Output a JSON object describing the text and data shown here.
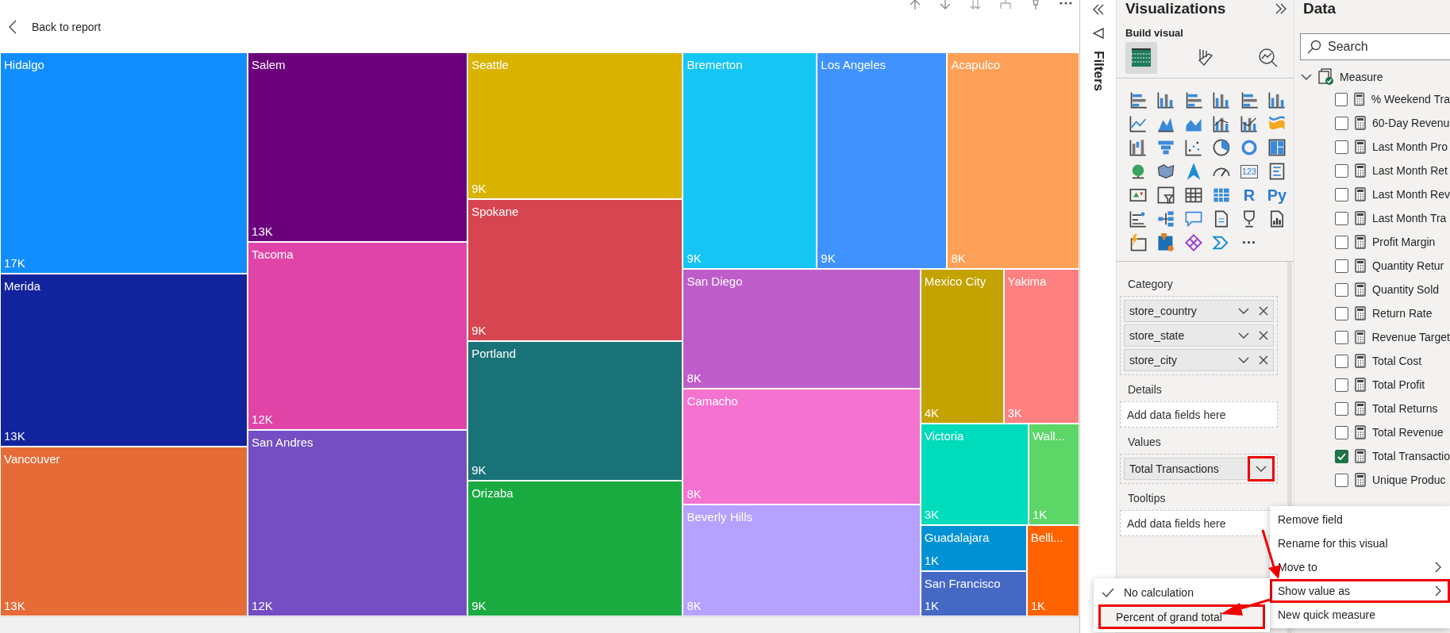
{
  "report": {
    "back_link": "Back to report"
  },
  "treemap": {
    "tiles": [
      {
        "name": "Hidalgo",
        "value": "17K",
        "color": "#118dff"
      },
      {
        "name": "Merida",
        "value": "13K",
        "color": "#12239e"
      },
      {
        "name": "Vancouver",
        "value": "13K",
        "color": "#e66c37"
      },
      {
        "name": "Salem",
        "value": "13K",
        "color": "#6b007b"
      },
      {
        "name": "Tacoma",
        "value": "12K",
        "color": "#e044a7"
      },
      {
        "name": "San Andres",
        "value": "12K",
        "color": "#744ec2"
      },
      {
        "name": "Seattle",
        "value": "9K",
        "color": "#d9b300"
      },
      {
        "name": "Spokane",
        "value": "9K",
        "color": "#d64550"
      },
      {
        "name": "Portland",
        "value": "9K",
        "color": "#197278"
      },
      {
        "name": "Orizaba",
        "value": "9K",
        "color": "#1aab40"
      },
      {
        "name": "Bremerton",
        "value": "9K",
        "color": "#15c6f4"
      },
      {
        "name": "Los Angeles",
        "value": "9K",
        "color": "#4092ff"
      },
      {
        "name": "Acapulco",
        "value": "8K",
        "color": "#ffa058"
      },
      {
        "name": "San Diego",
        "value": "8K",
        "color": "#be5dc9"
      },
      {
        "name": "Camacho",
        "value": "8K",
        "color": "#f472d0"
      },
      {
        "name": "Beverly Hills",
        "value": "8K",
        "color": "#b5a1ff"
      },
      {
        "name": "Mexico City",
        "value": "4K",
        "color": "#c4a200"
      },
      {
        "name": "Yakima",
        "value": "3K",
        "color": "#ff8080"
      },
      {
        "name": "Victoria",
        "value": "3K",
        "color": "#00dbbc"
      },
      {
        "name": "Wall...",
        "value": "1K",
        "color": "#5bd667"
      },
      {
        "name": "Guadalajara",
        "value": "1K",
        "color": "#0091d5"
      },
      {
        "name": "San Francisco",
        "value": "1K",
        "color": "#4668c5"
      },
      {
        "name": "Belli...",
        "value": "1K",
        "color": "#ff6300"
      }
    ]
  },
  "filters_pane": {
    "title": "Filters"
  },
  "visualizations": {
    "title": "Visualizations",
    "subtitle": "Build visual",
    "tabs": [
      {
        "selected": true
      },
      {
        "selected": false
      },
      {
        "selected": false
      }
    ],
    "gallery_glyphs": {
      "card": "123",
      "r": "R",
      "python": "Py",
      "more": "···"
    },
    "wells": [
      {
        "label": "Category",
        "fields": [
          {
            "name": "store_country",
            "removable": true,
            "highlighted": false
          },
          {
            "name": "store_state",
            "removable": true,
            "highlighted": false
          },
          {
            "name": "store_city",
            "removable": true,
            "highlighted": false
          }
        ]
      },
      {
        "label": "Details",
        "placeholder": "Add data fields here"
      },
      {
        "label": "Values",
        "fields": [
          {
            "name": "Total Transactions",
            "removable": false,
            "highlighted": true
          }
        ]
      },
      {
        "label": "Tooltips",
        "placeholder": "Add data fields here"
      }
    ]
  },
  "data": {
    "title": "Data",
    "search": {
      "placeholder": "Search"
    },
    "tables": [
      {
        "name": "Measure",
        "expanded": true,
        "children": [
          {
            "name": "% Weekend Tra",
            "checked": false
          },
          {
            "name": "60-Day Revenu",
            "checked": false
          },
          {
            "name": "Last Month Pro",
            "checked": false
          },
          {
            "name": "Last Month Ret",
            "checked": false
          },
          {
            "name": "Last Month Rev",
            "checked": false
          },
          {
            "name": "Last Month Tra",
            "checked": false
          },
          {
            "name": "Profit Margin",
            "checked": false
          },
          {
            "name": "Quantity Retur",
            "checked": false
          },
          {
            "name": "Quantity Sold",
            "checked": false
          },
          {
            "name": "Return Rate",
            "checked": false
          },
          {
            "name": "Revenue Target",
            "checked": false
          },
          {
            "name": "Total Cost",
            "checked": false
          },
          {
            "name": "Total Profit",
            "checked": false
          },
          {
            "name": "Total Returns",
            "checked": false
          },
          {
            "name": "Total Revenue",
            "checked": false
          },
          {
            "name": "Total Transactio",
            "checked": true
          },
          {
            "name": "Unique Produc",
            "checked": false
          }
        ]
      }
    ]
  },
  "field_menu": {
    "items": [
      {
        "label": "Remove field",
        "submenu": false,
        "highlighted": false
      },
      {
        "label": "Rename for this visual",
        "submenu": false,
        "highlighted": false
      },
      {
        "label": "Move to",
        "submenu": true,
        "highlighted": false
      },
      {
        "label": "Show value as",
        "submenu": true,
        "highlighted": true
      },
      {
        "label": "New quick measure",
        "submenu": false,
        "highlighted": false
      }
    ]
  },
  "value_submenu": {
    "items": [
      {
        "label": "No calculation",
        "checked": true,
        "highlighted": false
      },
      {
        "label": "Percent of grand total",
        "checked": false,
        "highlighted": true
      }
    ]
  }
}
